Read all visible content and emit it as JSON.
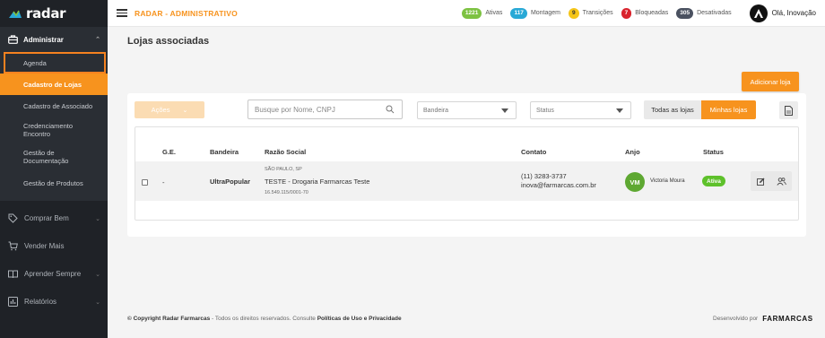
{
  "sidebar": {
    "logo_text": "radar",
    "administrar": {
      "label": "Administrar",
      "items": [
        {
          "label": "Agenda"
        },
        {
          "label": "Cadastro de Lojas"
        },
        {
          "label": "Cadastro de Associado"
        },
        {
          "label": "Credenciamento Encontro"
        },
        {
          "label": "Gestão de Documentação"
        },
        {
          "label": "Gestão de Produtos"
        }
      ]
    },
    "comprar": "Comprar Bem",
    "vender": "Vender Mais",
    "aprender": "Aprender Sempre",
    "relatorios": "Relatórios"
  },
  "topbar": {
    "title": "RADAR - ADMINISTRATIVO",
    "counters": [
      {
        "count": "1221",
        "label": "Ativas",
        "color": "#7dc242"
      },
      {
        "count": "117",
        "label": "Montagem",
        "color": "#29a9d6"
      },
      {
        "count": "9",
        "label": "Transições",
        "color": "#f5c518"
      },
      {
        "count": "7",
        "label": "Bloqueadas",
        "color": "#d9232d"
      },
      {
        "count": "305",
        "label": "Desativadas",
        "color": "#4a5160"
      }
    ],
    "user_greeting": "Olá, Inovação"
  },
  "page": {
    "title": "Lojas associadas",
    "add_button": "Adicionar loja",
    "acoes_label": "Ações",
    "search_placeholder": "Busque por Nome, CNPJ",
    "bandeira_placeholder": "Bandeira",
    "status_placeholder": "Status",
    "toggle_todas": "Todas as lojas",
    "toggle_minhas": "Minhas lojas"
  },
  "table": {
    "headers": {
      "ge": "G.E.",
      "bandeira": "Bandeira",
      "razao": "Razão Social",
      "contato": "Contato",
      "anjo": "Anjo",
      "status": "Status"
    },
    "rows": [
      {
        "ge": "-",
        "bandeira": "UltraPopular",
        "cidade": "SÃO PAULO, SP",
        "razao": "TESTE - Drogaria Farmarcas Teste",
        "cnpj": "16.549.115/0001-70",
        "telefone": "(11) 3283-3737",
        "email": "inova@farmarcas.com.br",
        "anjo_initials": "VM",
        "anjo_nome": "Victoria Moura",
        "status": "Ativa"
      }
    ]
  },
  "footer": {
    "copyright": "© Copyright Radar Farmarcas",
    "rights": " - Todos os direitos reservados. Consulte ",
    "policies": "Políticas de Uso e Privacidade",
    "developed_by": "Desenvolvido por",
    "brand": "FARMARCAS"
  }
}
